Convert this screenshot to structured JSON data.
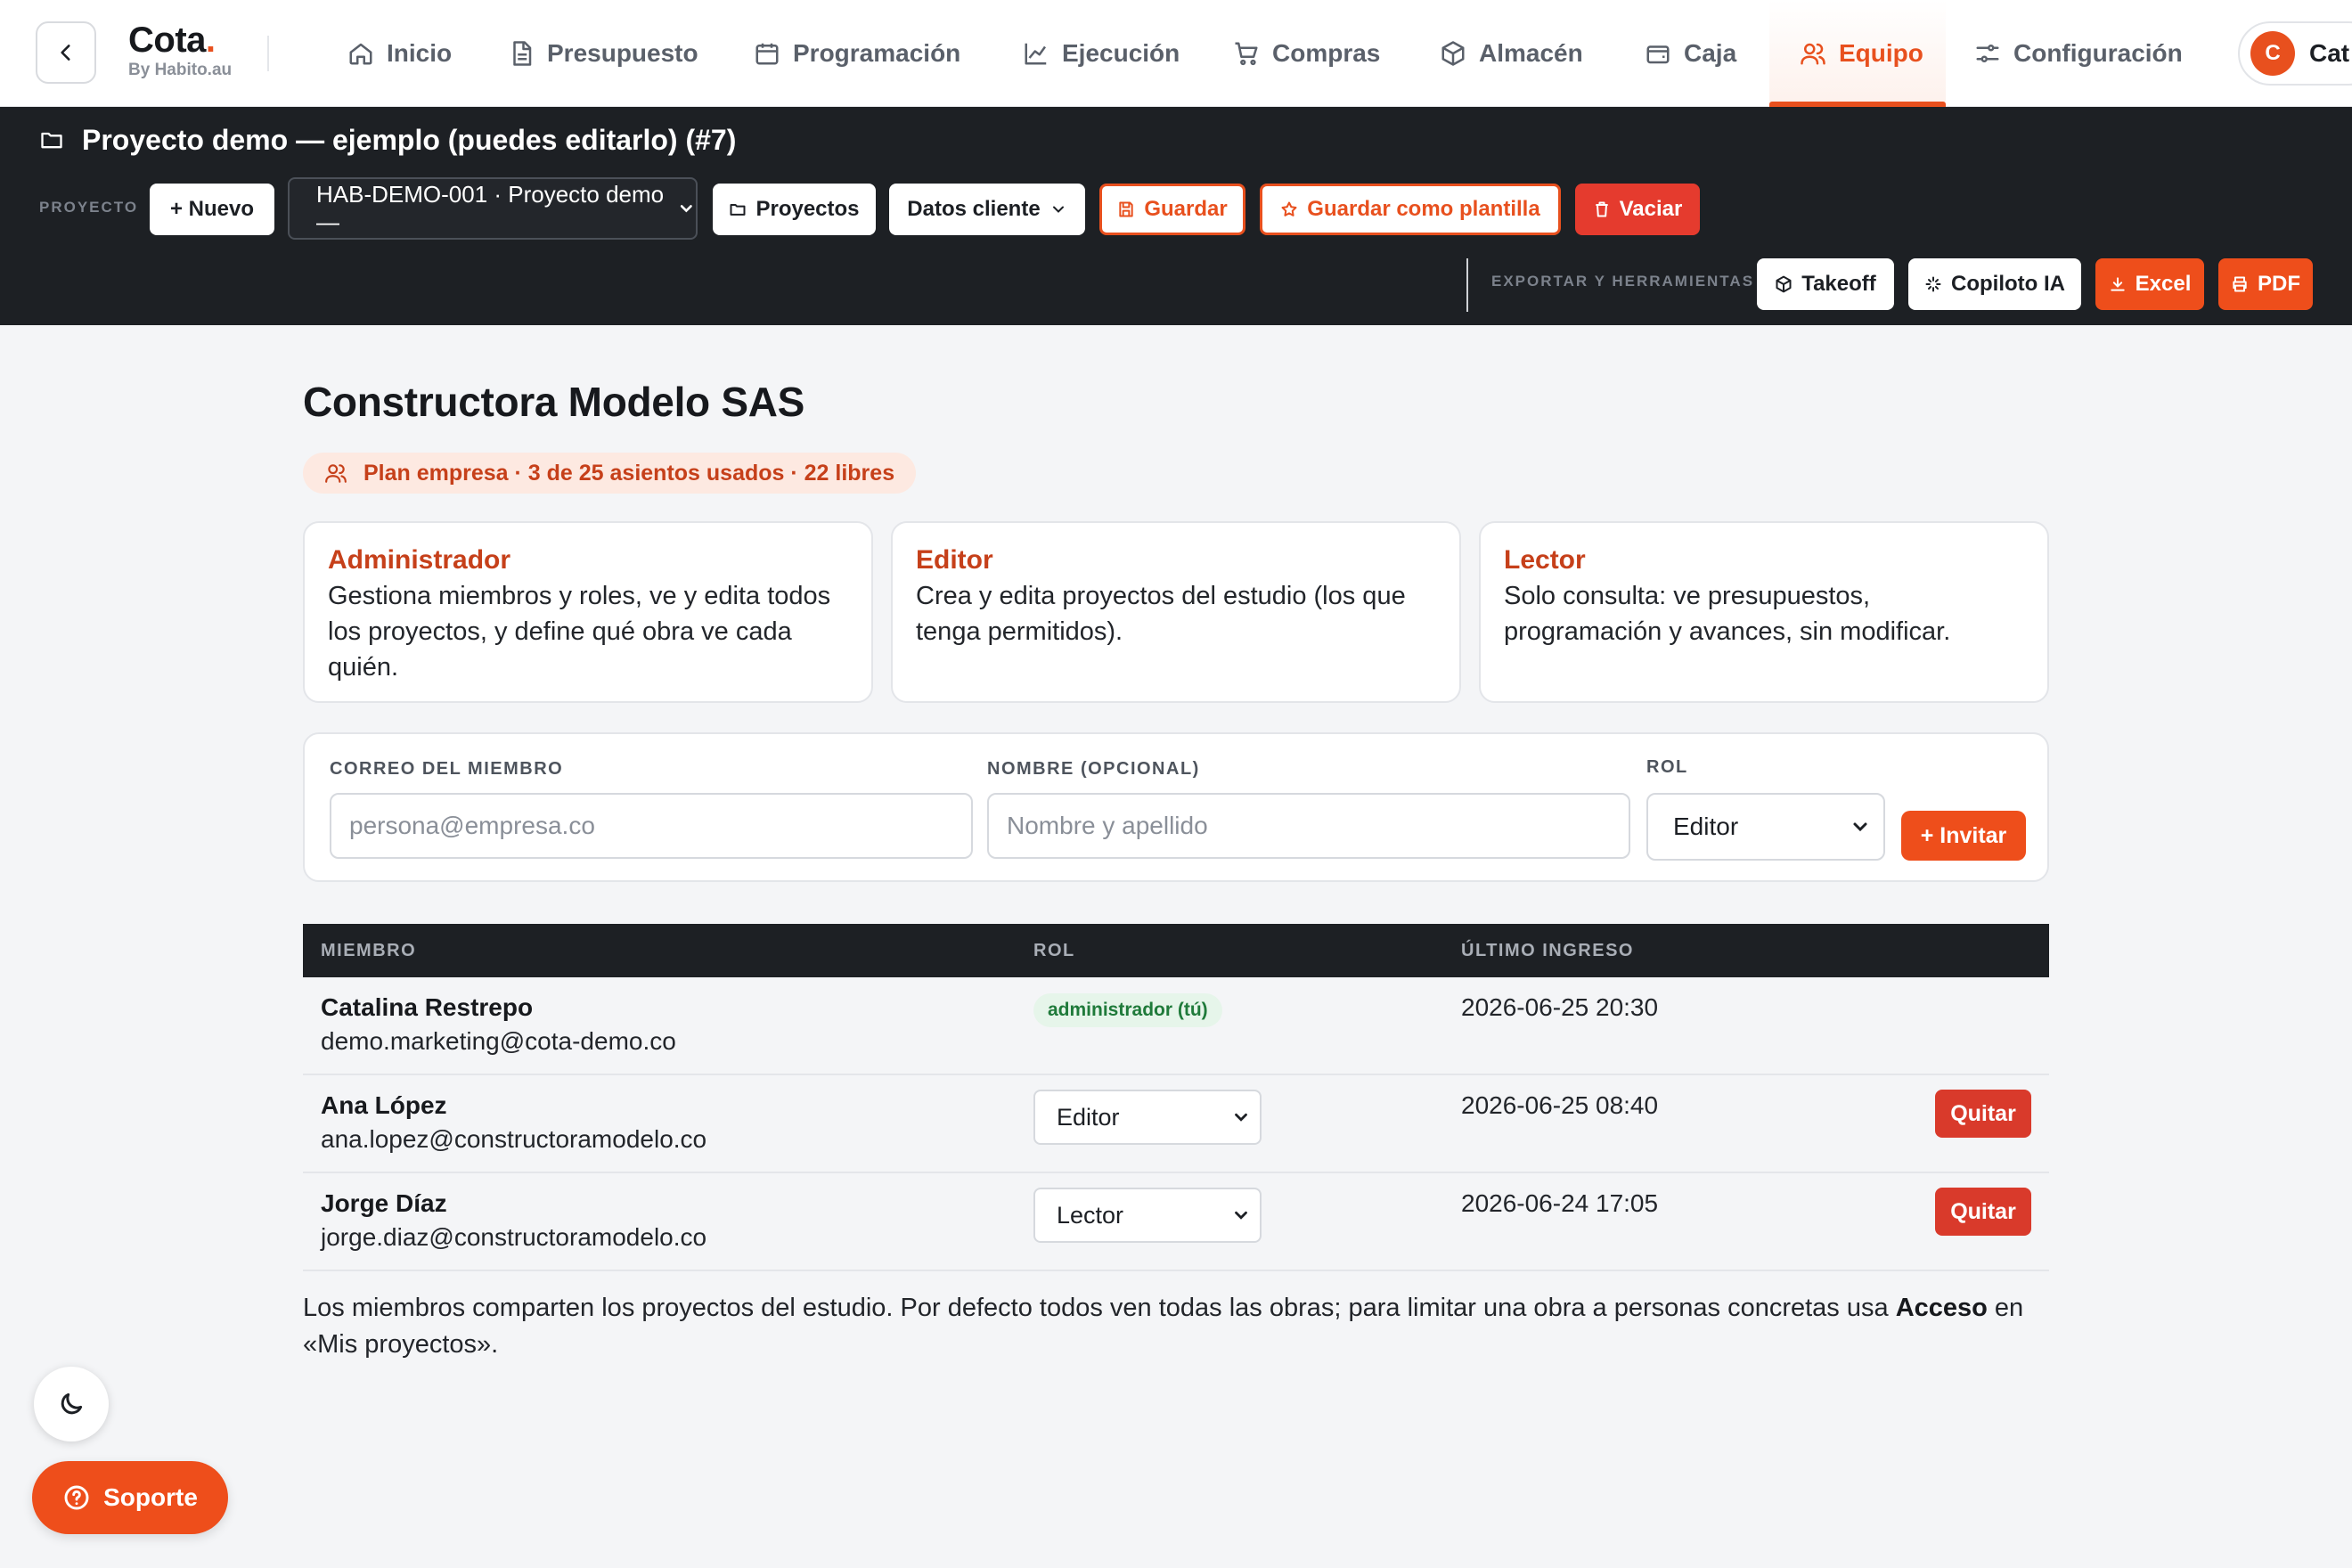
{
  "brand": {
    "name": "Cota",
    "dot": ".",
    "sub": "By Habito.au"
  },
  "nav": [
    {
      "label": "Inicio",
      "icon": "home-icon"
    },
    {
      "label": "Presupuesto",
      "icon": "document-icon"
    },
    {
      "label": "Programación",
      "icon": "calendar-icon"
    },
    {
      "label": "Ejecución",
      "icon": "chart-line-icon"
    },
    {
      "label": "Compras",
      "icon": "cart-icon"
    },
    {
      "label": "Almacén",
      "icon": "box-icon"
    },
    {
      "label": "Caja",
      "icon": "wallet-icon"
    },
    {
      "label": "Equipo",
      "icon": "users-icon",
      "active": true
    },
    {
      "label": "Configuración",
      "icon": "sliders-icon"
    }
  ],
  "user": {
    "initial": "C",
    "name": "Cat"
  },
  "project": {
    "title": "Proyecto demo — ejemplo (puedes editarlo) (#7)",
    "section_label": "PROYECTO",
    "new_label": "+ Nuevo",
    "select_value": "HAB-DEMO-001 · Proyecto demo —",
    "projects_label": "Proyectos",
    "client_label": "Datos cliente",
    "save_label": "Guardar",
    "save_template_label": "Guardar como plantilla",
    "clear_label": "Vaciar",
    "tools_label": "EXPORTAR Y HERRAMIENTAS",
    "takeoff_label": "Takeoff",
    "copilot_label": "Copiloto IA",
    "excel_label": "Excel",
    "pdf_label": "PDF"
  },
  "company": "Constructora Modelo SAS",
  "plan_badge": "Plan empresa · 3 de 25 asientos usados · 22 libres",
  "roles": [
    {
      "title": "Administrador",
      "desc": "Gestiona miembros y roles, ve y edita todos los proyectos, y define qué obra ve cada quién."
    },
    {
      "title": "Editor",
      "desc": "Crea y edita proyectos del estudio (los que tenga permitidos)."
    },
    {
      "title": "Lector",
      "desc": "Solo consulta: ve presupuestos, programación y avances, sin modificar."
    }
  ],
  "invite": {
    "email_label": "CORREO DEL MIEMBRO",
    "email_placeholder": "persona@empresa.co",
    "name_label": "NOMBRE (OPCIONAL)",
    "name_placeholder": "Nombre y apellido",
    "role_label": "ROL",
    "role_value": "Editor",
    "button_label": "+ Invitar"
  },
  "members_table": {
    "headers": {
      "member": "MIEMBRO",
      "role": "ROL",
      "last_login": "ÚLTIMO INGRESO"
    },
    "rows": [
      {
        "name": "Catalina Restrepo",
        "email": "demo.marketing@cota-demo.co",
        "role": "administrador (tú)",
        "last_login": "2026-06-25 20:30"
      },
      {
        "name": "Ana López",
        "email": "ana.lopez@constructoramodelo.co",
        "role": "Editor",
        "last_login": "2026-06-25 08:40",
        "remove_label": "Quitar"
      },
      {
        "name": "Jorge Díaz",
        "email": "jorge.diaz@constructoramodelo.co",
        "role": "Lector",
        "last_login": "2026-06-24 17:05",
        "remove_label": "Quitar"
      }
    ]
  },
  "footnote": {
    "text1": "Los miembros comparten los proyectos del estudio. Por defecto todos ven todas las obras; para limitar una obra a personas concretas usa ",
    "bold": "Acceso",
    "text2": " en «Mis proyectos»."
  },
  "support_label": "Soporte",
  "colors": {
    "accent": "#e8501e",
    "danger": "#d93a2b",
    "dark_bar": "#1d2024",
    "success": "#1f7a3a"
  }
}
